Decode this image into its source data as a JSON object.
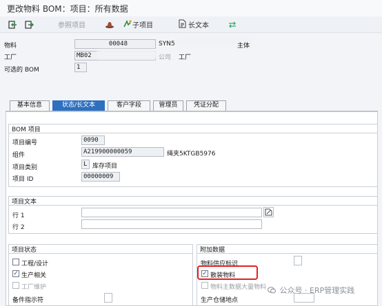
{
  "window": {
    "title": "更改物料 BOM：项目：所有数据"
  },
  "toolbar": {
    "ref_item": "参照项目",
    "sub_item": "子项目",
    "long_text": "长文本"
  },
  "header": {
    "material_label": "物料",
    "material_value": "00048",
    "material_desc_prefix": "SYN5",
    "material_desc_suffix": "主体",
    "plant_label": "工厂",
    "plant_value": "MB02",
    "plant_desc_prefix": "公司",
    "plant_desc_suffix": "工厂",
    "alt_bom_label": "可选的 BOM",
    "alt_bom_value": "1"
  },
  "tabs": [
    "基本信息",
    "状态/长文本",
    "客户字段",
    "管理员",
    "凭证分配"
  ],
  "bom_item": {
    "section_title": "BOM 项目",
    "item_no_label": "项目编号",
    "item_no_value": "0090",
    "component_label": "组件",
    "component_value": "A219900000059",
    "component_desc": "绳夹5KTGB5976",
    "category_label": "项目类别",
    "category_value": "L",
    "category_desc": "库存项目",
    "item_id_label": "项目 ID",
    "item_id_value": "00000009"
  },
  "item_text": {
    "section_title": "项目文本",
    "line1_label": "行 1",
    "line1_value": "",
    "line2_label": "行 2",
    "line2_value": ""
  },
  "item_status": {
    "section_title": "项目状态",
    "engineering": {
      "label": "工程/设计",
      "checked": false
    },
    "production": {
      "label": "生产相关",
      "checked": true
    },
    "plant_maint": {
      "label": "工厂维护",
      "checked": false
    },
    "spare_part_label": "备件指示符",
    "spare_part_value": ""
  },
  "additional": {
    "section_title": "附加数据",
    "supply_label": "物料供应标识",
    "bulk_material": {
      "label": "散装物料",
      "checked": true
    },
    "bulk_master": {
      "label": "物料主数据大量物料",
      "checked": false
    },
    "storage_label": "生产仓储地点"
  },
  "watermark": "公众号 · ERP管理实践",
  "colors": {
    "accent": "#2e6fc0",
    "highlight": "#e02020"
  }
}
